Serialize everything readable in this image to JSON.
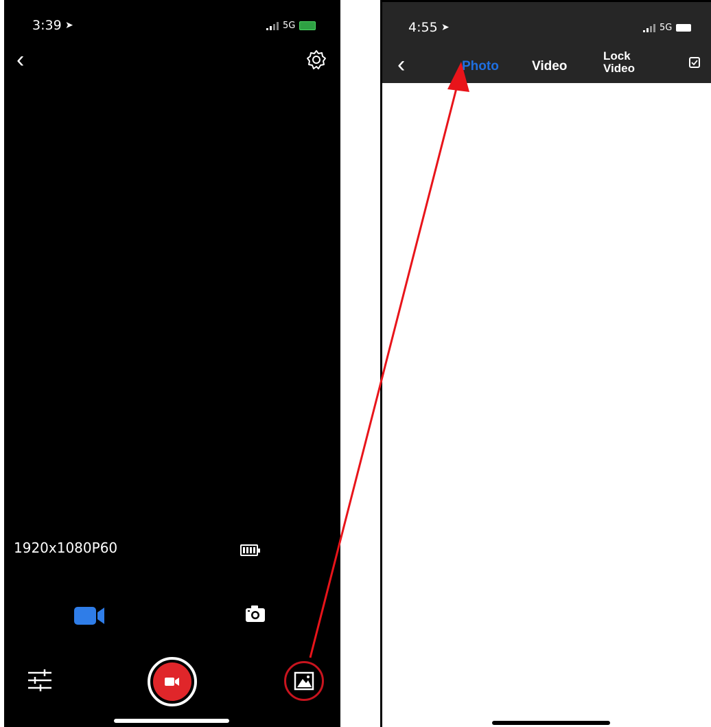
{
  "left_screen": {
    "status_time": "3:39",
    "network": "5G",
    "resolution_label": "1920x1080P60",
    "icons": {
      "back": "chevron-left-icon",
      "settings": "gear-icon",
      "battery": "camera-battery-icon",
      "video_mode": "video-camera-icon",
      "photo_mode": "camera-icon",
      "adjust": "sliders-icon",
      "record": "record-button",
      "gallery": "gallery-icon"
    },
    "colors": {
      "record": "#e0262a",
      "active_mode": "#2f7de8",
      "highlight_circle": "#c8141e"
    }
  },
  "right_screen": {
    "status_time": "4:55",
    "network": "5G",
    "tabs": [
      {
        "label": "Photo",
        "active": true
      },
      {
        "label": "Video",
        "active": false
      },
      {
        "label": "Lock Video",
        "active": false
      }
    ],
    "icons": {
      "back": "chevron-left-icon",
      "select": "checkbox-icon"
    },
    "colors": {
      "active_tab": "#1f6fe0",
      "header_bg": "#262626"
    }
  },
  "annotation": {
    "arrow_color": "#e8141a",
    "arrow": "gallery-to-photo-tab"
  }
}
